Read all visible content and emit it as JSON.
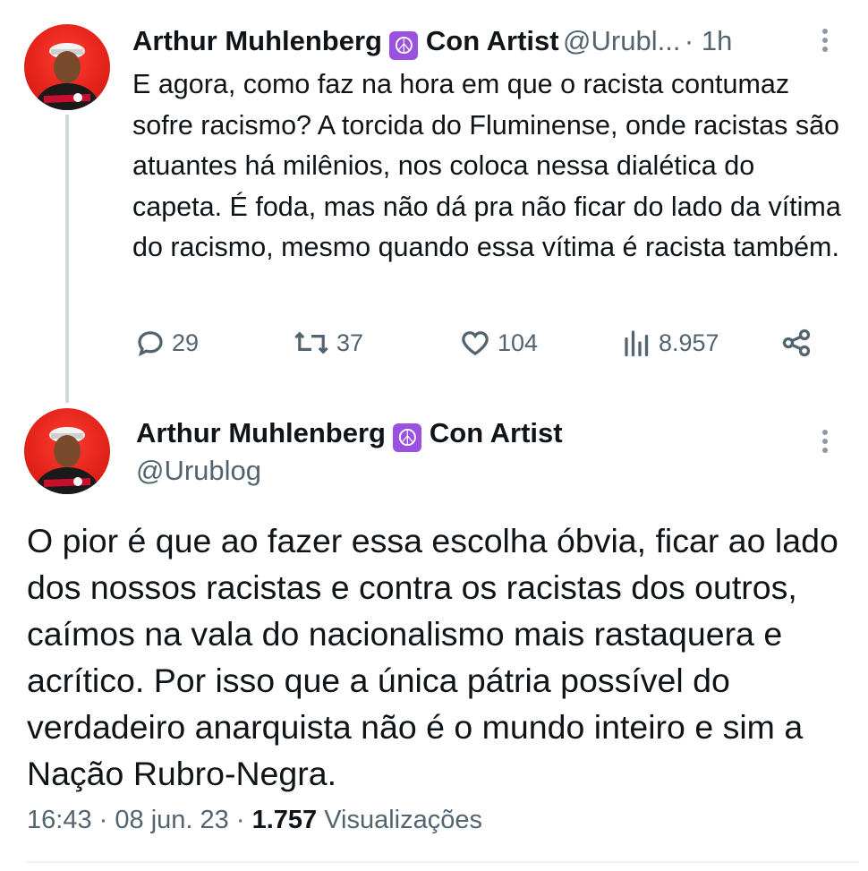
{
  "tweet1": {
    "author_name": "Arthur Muhlenberg",
    "badge": "☮",
    "author_suffix": "Con Artist",
    "handle": "@Urubl...",
    "time": "· 1h",
    "text": "E agora, como faz na hora em que o racista contumaz sofre racismo? A torcida do Fluminense, onde racistas são atuantes há milênios, nos coloca nessa dialética do capeta. É foda, mas não dá pra não ficar do lado da vítima do racismo, mesmo quando essa vítima é racista também.",
    "replies": "29",
    "retweets": "37",
    "likes": "104",
    "views": "8.957"
  },
  "tweet2": {
    "author_name": "Arthur Muhlenberg",
    "badge": "☮",
    "author_suffix": "Con Artist",
    "handle": "@Urublog",
    "text": "O pior é que ao fazer essa escolha óbvia, ficar ao lado dos nossos racistas e contra os racistas dos outros, caímos na vala do nacionalismo mais rastaquera e acrítico. Por isso que a única pátria possível do verdadeiro anarquista não é o mundo inteiro e sim a Nação Rubro-Negra.",
    "time": "16:43",
    "date": "08 jun. 23",
    "views_count": "1.757",
    "views_label": "Visualizações"
  },
  "colors": {
    "text": "#0f1419",
    "muted": "#536471",
    "badge": "#9b51e0",
    "avatar_bg": "#e2231a",
    "thread_line": "#cfd9de"
  },
  "icons": [
    "reply-icon",
    "retweet-icon",
    "like-icon",
    "views-icon",
    "share-icon",
    "more-icon",
    "avatar-image"
  ]
}
